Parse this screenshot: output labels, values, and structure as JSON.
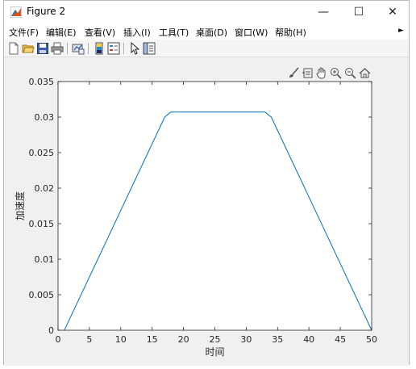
{
  "window": {
    "title": "Figure 2",
    "controls": {
      "minimize": "—",
      "maximize": "☐",
      "close": "✕"
    }
  },
  "menu": {
    "items": [
      "文件(F)",
      "编辑(E)",
      "查看(V)",
      "插入(I)",
      "工具(T)",
      "桌面(D)",
      "窗口(W)",
      "帮助(H)"
    ],
    "overflow_arrow": "►"
  },
  "toolbar": {
    "buttons": [
      "new-figure",
      "open-file",
      "save",
      "print",
      "link-plot",
      "insert-colorbar",
      "insert-legend",
      "edit-plot",
      "property-inspector"
    ]
  },
  "axes_toolbar": {
    "buttons": [
      "brush",
      "data-tips",
      "pan",
      "zoom-in",
      "zoom-out",
      "restore-view"
    ]
  },
  "colors": {
    "line": "#0072bd",
    "axis": "#262626",
    "background": "#f0f0f0",
    "plot_bg": "#ffffff"
  },
  "chart_data": {
    "type": "line",
    "xlabel": "时间",
    "ylabel": "加速度",
    "xlim": [
      0,
      50
    ],
    "ylim": [
      0,
      0.035
    ],
    "xticks": [
      "0",
      "5",
      "10",
      "15",
      "20",
      "25",
      "30",
      "35",
      "40",
      "45",
      "50"
    ],
    "yticks": [
      "0",
      "0.005",
      "0.01",
      "0.015",
      "0.02",
      "0.025",
      "0.03",
      "0.035"
    ],
    "grid": false,
    "series": [
      {
        "x": [
          1,
          17,
          18,
          33,
          34,
          50
        ],
        "y": [
          0,
          0.03,
          0.0307,
          0.0307,
          0.03,
          0
        ]
      }
    ]
  }
}
